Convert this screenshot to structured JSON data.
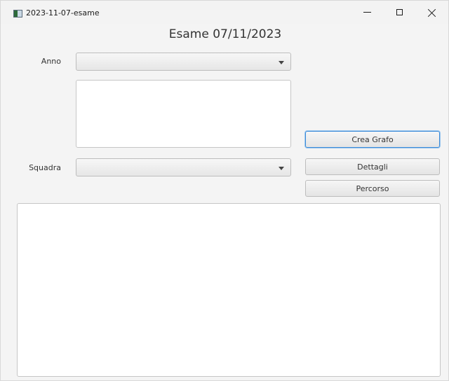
{
  "window": {
    "title": "2023-11-07-esame"
  },
  "heading": "Esame 07/11/2023",
  "form": {
    "anno_label": "Anno",
    "anno_value": "",
    "squadra_label": "Squadra",
    "squadra_value": "",
    "list_items": []
  },
  "buttons": {
    "crea_grafo": "Crea Grafo",
    "dettagli": "Dettagli",
    "percorso": "Percorso"
  },
  "output_text": "",
  "icons": {
    "app": "app-window-icon",
    "minimize": "minimize-icon",
    "maximize": "maximize-icon",
    "close": "close-icon",
    "dropdown": "chevron-down-icon"
  },
  "colors": {
    "focus_ring": "#3a8ad8",
    "background": "#f4f4f4"
  }
}
